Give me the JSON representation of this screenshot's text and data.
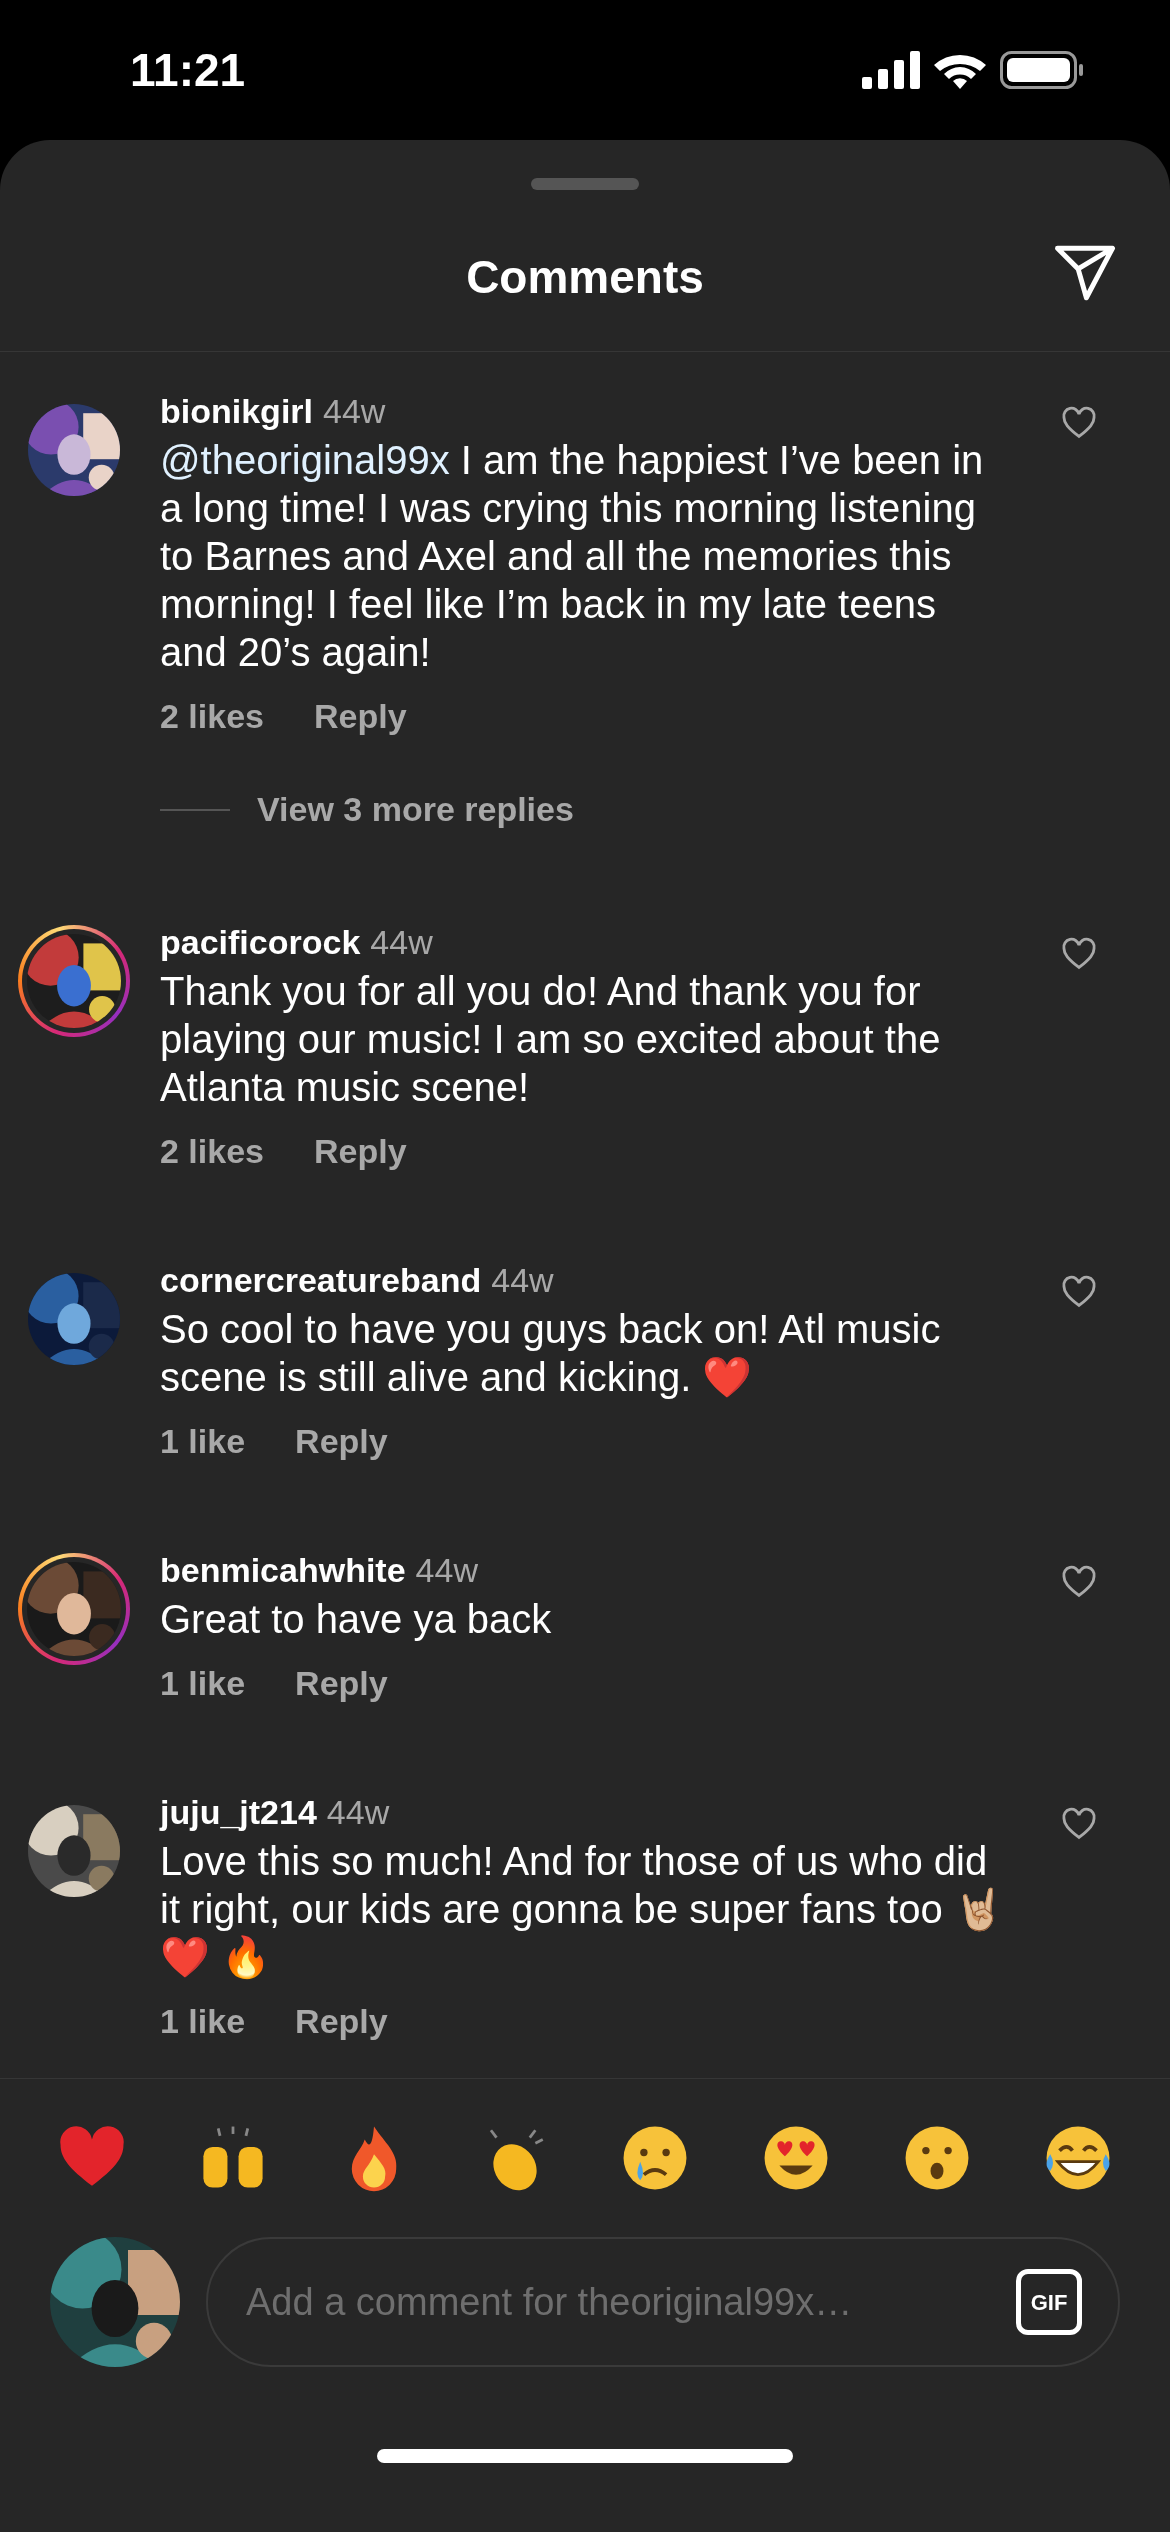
{
  "status_bar": {
    "time": "11:21"
  },
  "header": {
    "title": "Comments"
  },
  "comments": [
    {
      "username": "bionikgirl",
      "age": "44w",
      "story_ring": false,
      "text": "I am the happiest I’ve been in a long time! I was crying this morning listening to Barnes and Axel and all the memories this morning! I feel like I’m back in my late teens and 20’s again!",
      "mention": "@theoriginal99x",
      "likes": "2 likes",
      "reply": "Reply",
      "liked": false,
      "more_replies": "View 3 more replies"
    },
    {
      "username": "pacificorock",
      "age": "44w",
      "story_ring": true,
      "text": "Thank you for all you do! And thank you for playing our music! I am so excited about the Atlanta music scene!",
      "likes": "2 likes",
      "reply": "Reply",
      "liked": false
    },
    {
      "username": "cornercreatureband",
      "age": "44w",
      "story_ring": false,
      "text": "So cool to have you guys back on! Atl music scene is still alive and kicking. ❤️",
      "likes": "1 like",
      "reply": "Reply",
      "liked": false
    },
    {
      "username": "benmicahwhite",
      "age": "44w",
      "story_ring": true,
      "text": "Great to have ya back",
      "likes": "1 like",
      "reply": "Reply",
      "liked": false
    },
    {
      "username": "juju_jt214",
      "age": "44w",
      "story_ring": false,
      "text": "Love this so much!  And for those of us who did it right, our kids are gonna be super fans too 🤘🏼 ❤️ 🔥",
      "likes": "1 like",
      "reply": "Reply",
      "liked": false
    }
  ],
  "reactions": [
    {
      "kind": "heart"
    },
    {
      "kind": "raised-hands"
    },
    {
      "kind": "fire"
    },
    {
      "kind": "clap"
    },
    {
      "kind": "crying"
    },
    {
      "kind": "heart-eyes"
    },
    {
      "kind": "surprised"
    },
    {
      "kind": "laughing"
    }
  ],
  "composer": {
    "placeholder": "Add a comment for theoriginal99x…",
    "gif_label": "GIF"
  }
}
